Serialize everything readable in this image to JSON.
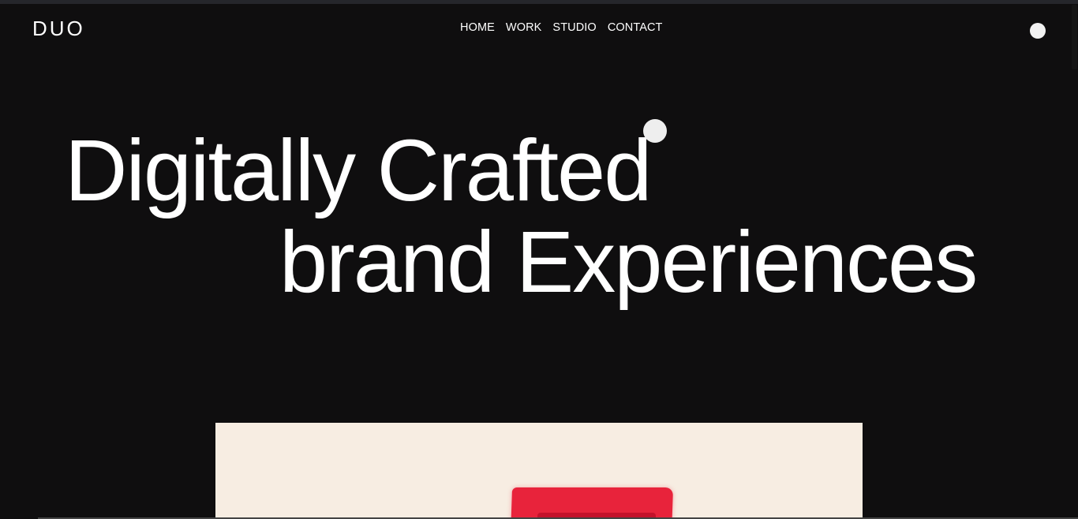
{
  "brand": {
    "logo": "DUO"
  },
  "nav": {
    "items": [
      {
        "label": "HOME"
      },
      {
        "label": "WORK"
      },
      {
        "label": "STUDIO"
      },
      {
        "label": "CONTACT"
      }
    ]
  },
  "hero": {
    "line1": "Digitally Crafted",
    "line2": "brand Experiences"
  },
  "icons": {
    "menu": "menu-dot-icon",
    "cursor": "cursor-dot-icon"
  },
  "colors": {
    "background": "#0f0e0f",
    "text": "#ffffff",
    "image_background": "#f7ede2",
    "accent_red": "#e8233b"
  }
}
